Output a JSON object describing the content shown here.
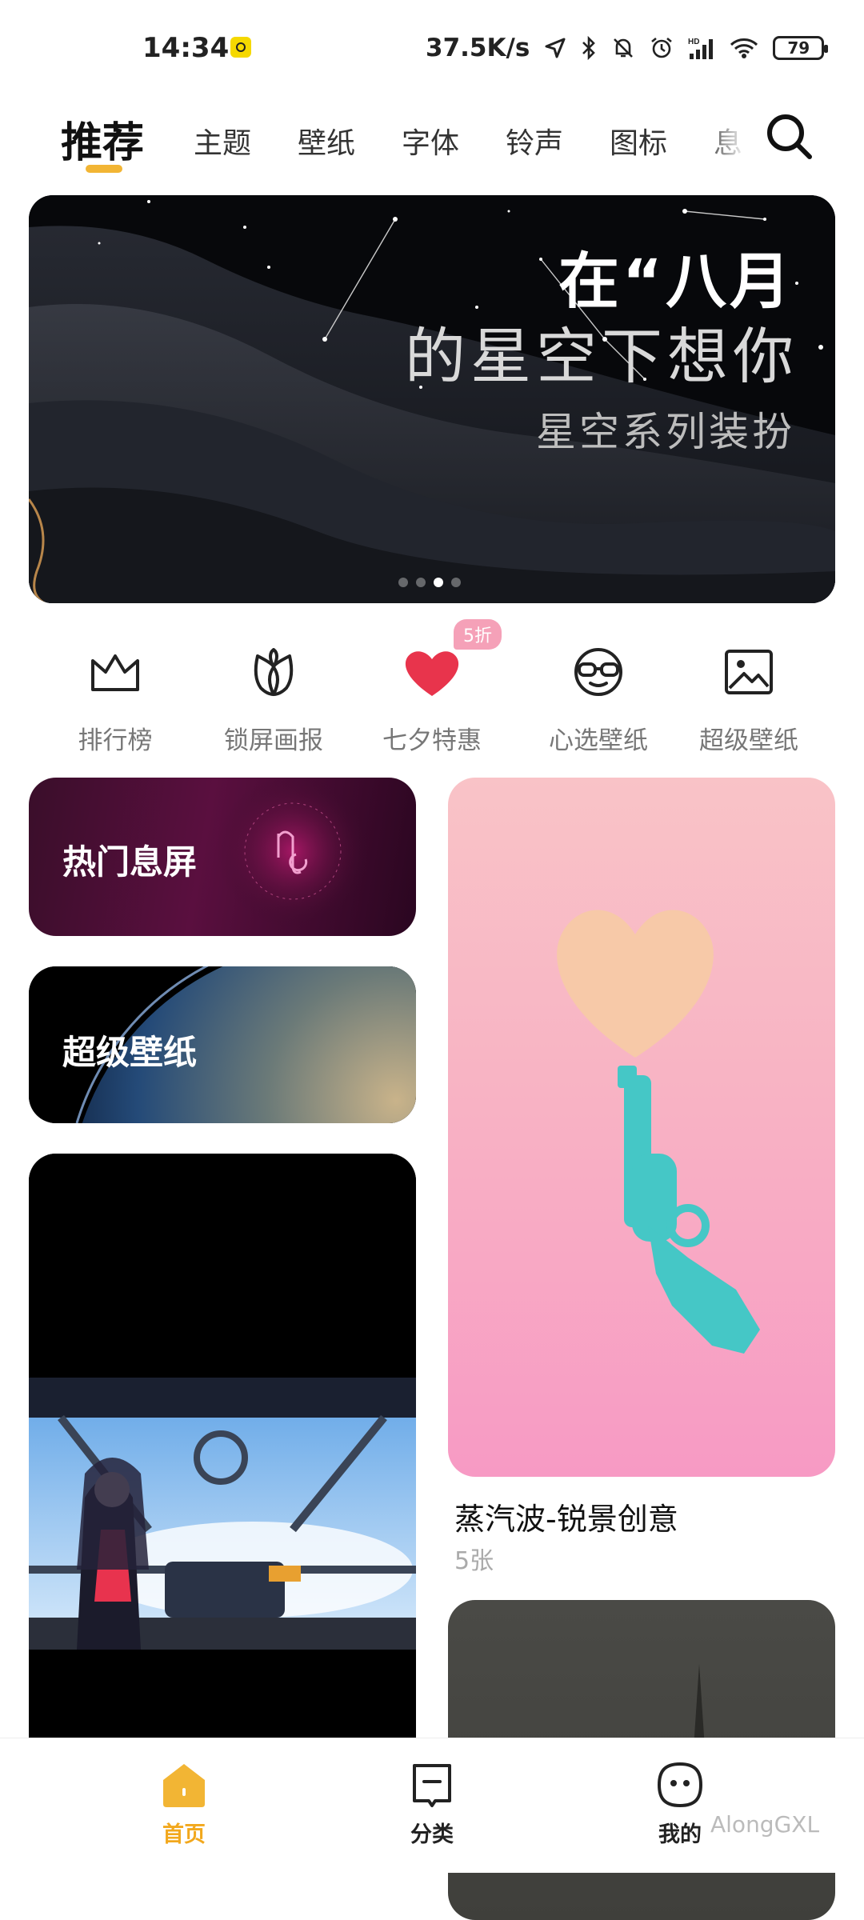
{
  "status_bar": {
    "time": "14:34",
    "network_speed": "37.5K/s",
    "battery": "79"
  },
  "tabs": [
    {
      "label": "推荐",
      "active": true
    },
    {
      "label": "主题"
    },
    {
      "label": "壁纸"
    },
    {
      "label": "字体"
    },
    {
      "label": "铃声"
    },
    {
      "label": "图标"
    },
    {
      "label": "息"
    }
  ],
  "banner": {
    "line1": "在“八月",
    "line2": "的星空下想你",
    "subtitle": "星空系列装扮",
    "page_count": 4,
    "active_page": 3
  },
  "quick_links": [
    {
      "label": "排行榜",
      "icon": "crown-icon"
    },
    {
      "label": "锁屏画报",
      "icon": "tulip-icon"
    },
    {
      "label": "七夕特惠",
      "icon": "heart-icon",
      "badge": "5折"
    },
    {
      "label": "心选壁纸",
      "icon": "glasses-face-icon"
    },
    {
      "label": "超级壁纸",
      "icon": "image-icon"
    }
  ],
  "cards": {
    "hot": {
      "label": "热门息屏"
    },
    "super": {
      "label": "超级壁纸"
    },
    "vapor": {
      "title": "蒸汽波-锐景创意",
      "count": "5张"
    }
  },
  "bottom_nav": [
    {
      "label": "首页",
      "icon": "home-icon",
      "active": true
    },
    {
      "label": "分类",
      "icon": "bookmark-icon"
    },
    {
      "label": "我的",
      "icon": "smile-face-icon"
    }
  ],
  "watermark": "AlongGXL",
  "colors": {
    "accent": "#f2b534",
    "active_nav": "#f2a81d",
    "heart": "#e8344c",
    "badge": "#f5a1b8"
  }
}
